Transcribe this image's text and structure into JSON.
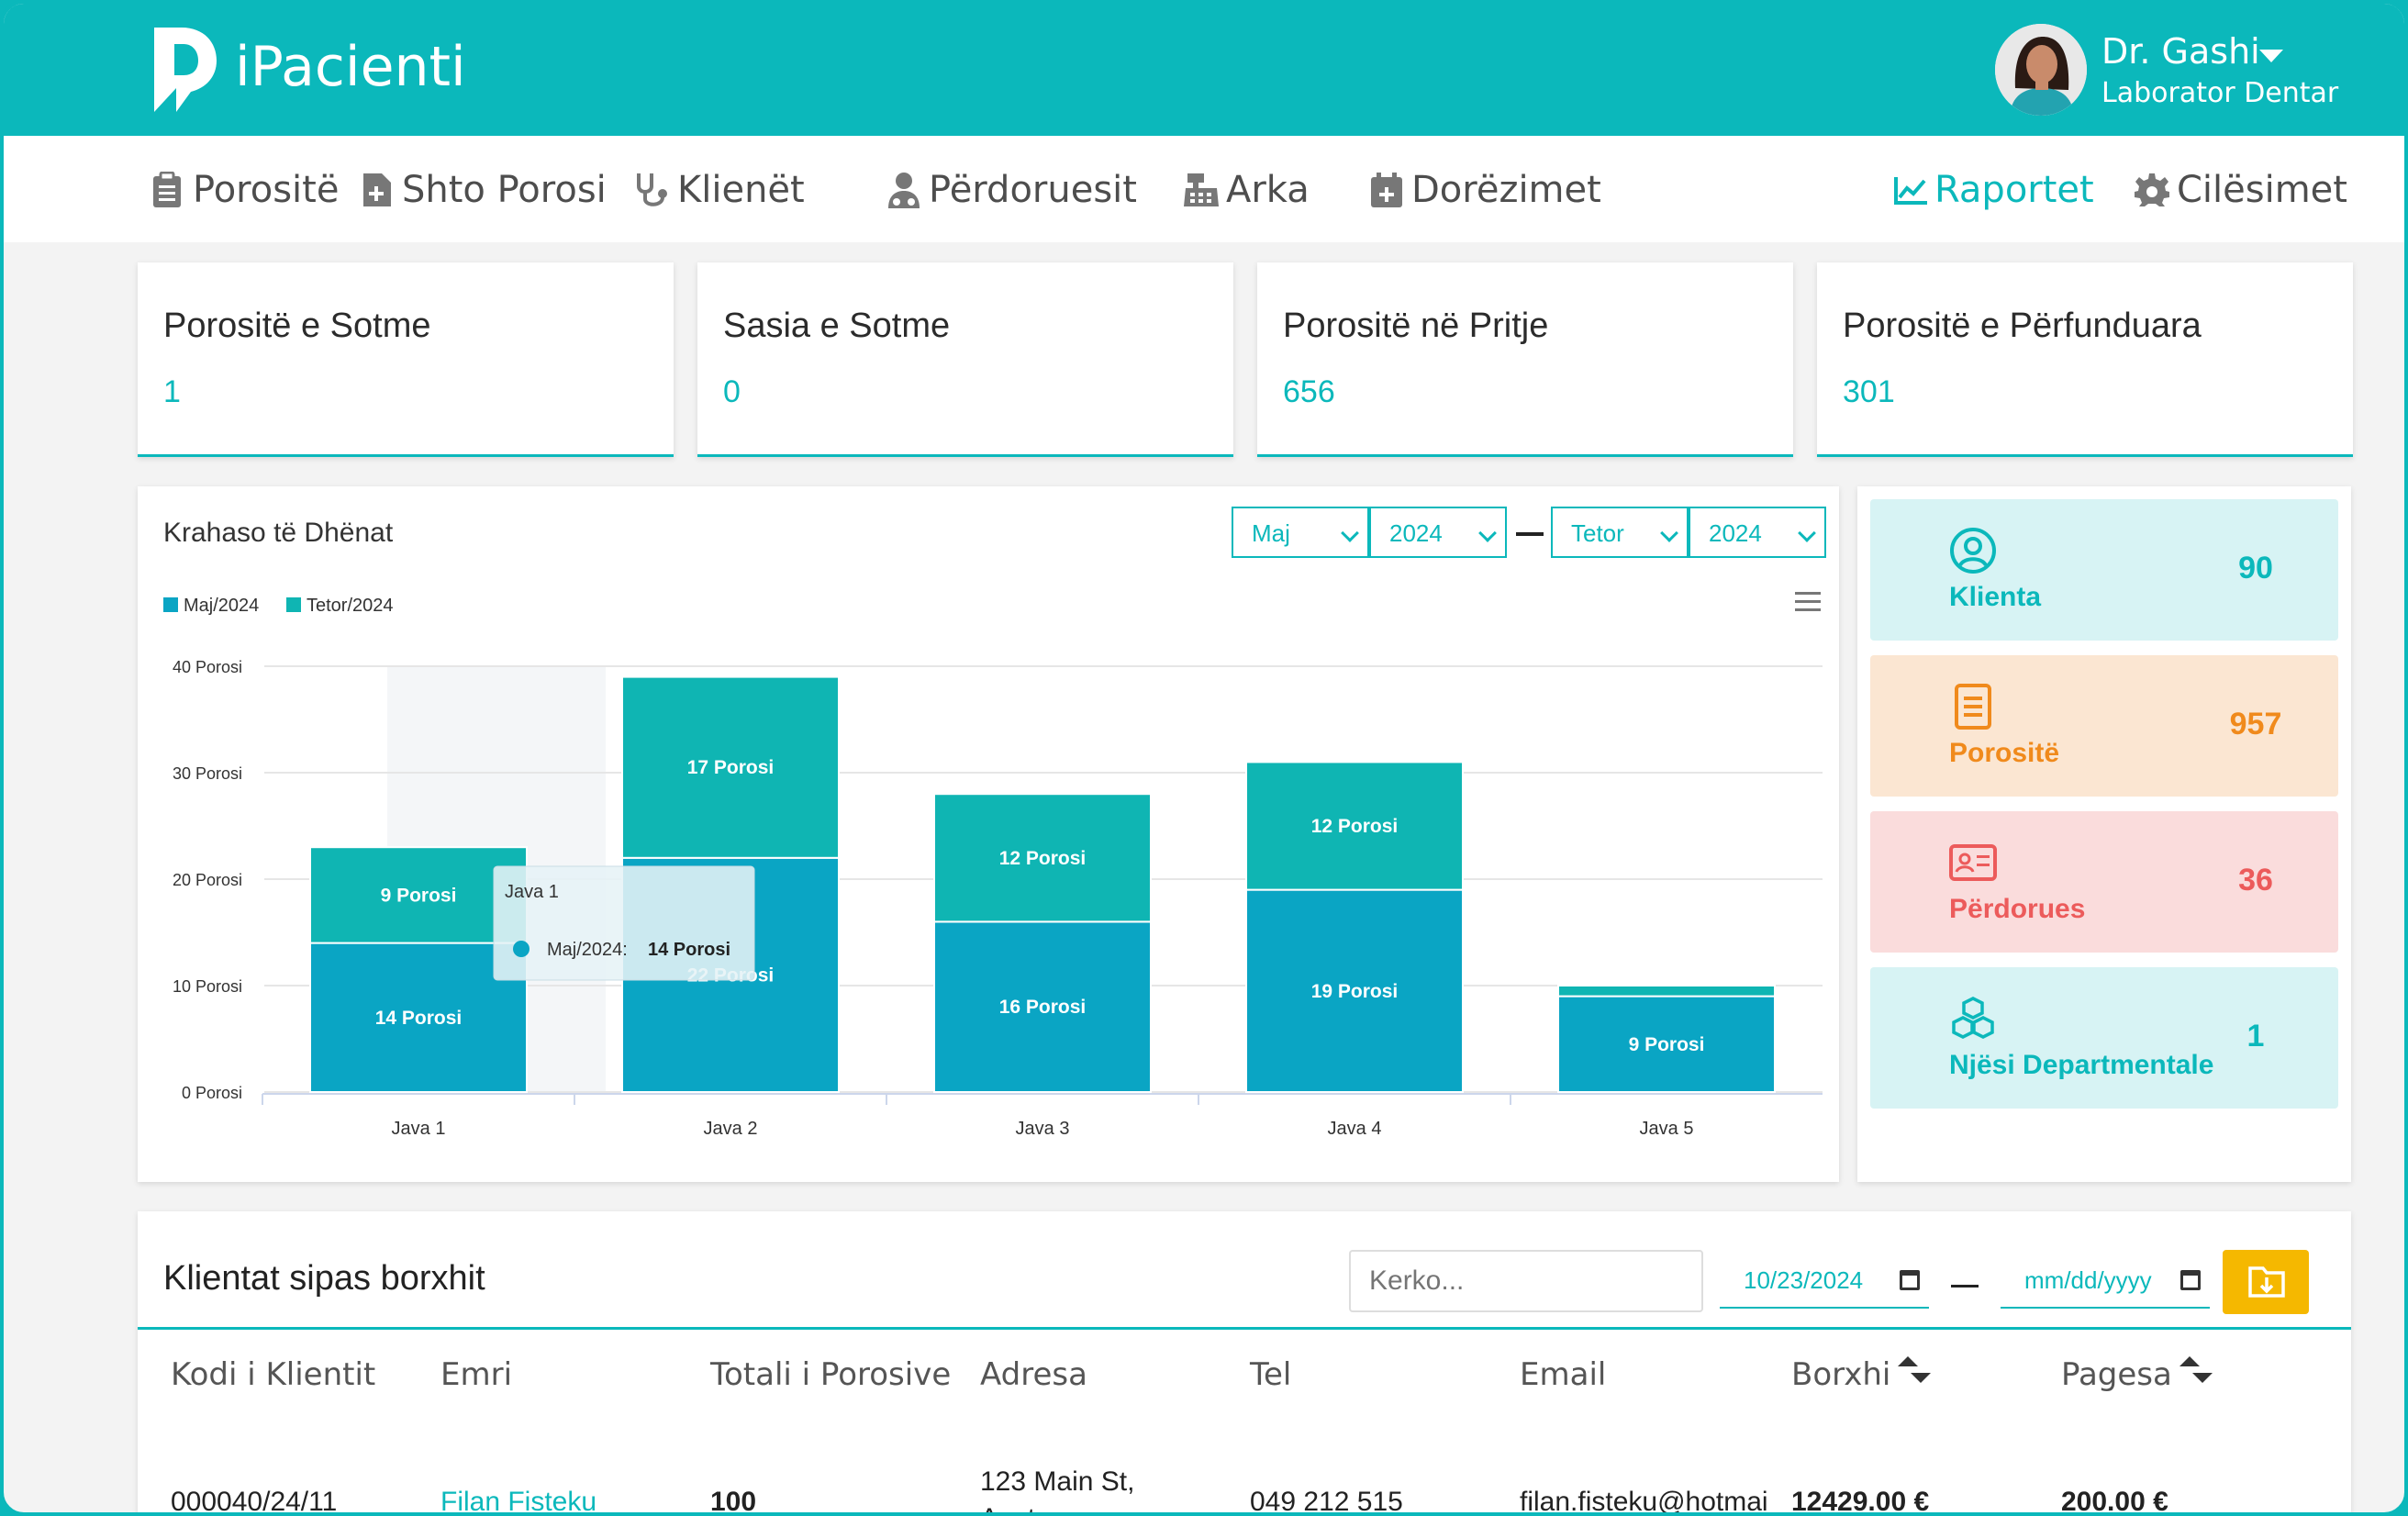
{
  "header": {
    "app_name": "iPacienti",
    "user_name": "Dr. Gashi",
    "user_role": "Laborator Dentar"
  },
  "nav": {
    "items": [
      {
        "label": "Porositë",
        "icon": "clipboard-icon"
      },
      {
        "label": "Shto Porosi",
        "icon": "file-plus-icon"
      },
      {
        "label": "Klienët",
        "icon": "stethoscope-icon"
      },
      {
        "label": "Përdoruesit",
        "icon": "users-icon"
      },
      {
        "label": "Arka",
        "icon": "cash-register-icon"
      },
      {
        "label": "Dorëzimet",
        "icon": "calendar-plus-icon"
      }
    ],
    "right": [
      {
        "label": "Raportet",
        "icon": "line-chart-icon",
        "active": true
      },
      {
        "label": "Cilësimet",
        "icon": "gear-icon"
      }
    ]
  },
  "stats": [
    {
      "title": "Porositë e Sotme",
      "value": "1"
    },
    {
      "title": "Sasia e Sotme",
      "value": "0"
    },
    {
      "title": "Porositë në Pritje",
      "value": "656"
    },
    {
      "title": "Porositë e Përfunduara",
      "value": "301"
    }
  ],
  "compare": {
    "title": "Krahaso të Dhënat",
    "from_month": "Maj",
    "from_year": "2024",
    "to_month": "Tetor",
    "to_year": "2024"
  },
  "chart_data": {
    "type": "bar",
    "stacked": true,
    "categories": [
      "Java 1",
      "Java 2",
      "Java 3",
      "Java 4",
      "Java 5"
    ],
    "series": [
      {
        "name": "Maj/2024",
        "values": [
          14,
          22,
          16,
          19,
          9
        ],
        "color": "#0aa5c4"
      },
      {
        "name": "Tetor/2024",
        "values": [
          9,
          17,
          12,
          12,
          1
        ],
        "color": "#0fb5b3"
      }
    ],
    "ylim": [
      0,
      40
    ],
    "yticks": [
      {
        "value": 0,
        "label": "0 Porosi"
      },
      {
        "value": 10,
        "label": "10 Porosi"
      },
      {
        "value": 20,
        "label": "20 Porosi"
      },
      {
        "value": 30,
        "label": "30 Porosi"
      },
      {
        "value": 40,
        "label": "40 Porosi"
      }
    ],
    "data_label_suffix": " Porosi",
    "legend_position": "top-left",
    "tooltip": {
      "title": "Java 1",
      "series": "Maj/2024:",
      "value": "14 Porosi"
    }
  },
  "side_cards": [
    {
      "label": "Klienta",
      "value": "90",
      "icon": "user-circle-icon",
      "color": "#0bb8bb",
      "bg": "#d7f3f4"
    },
    {
      "label": "Porositë",
      "value": "957",
      "icon": "document-icon",
      "color": "#f08a1c",
      "bg": "#fbe6d2"
    },
    {
      "label": "Përdorues",
      "value": "36",
      "icon": "id-card-icon",
      "color": "#ec5b5b",
      "bg": "#fadcdc"
    },
    {
      "label": "Njësi Departmentale",
      "value": "1",
      "icon": "cubes-icon",
      "color": "#0bb8bb",
      "bg": "#d7f3f4"
    }
  ],
  "debt_table": {
    "title": "Klientat sipas borxhit",
    "search_placeholder": "Kerko...",
    "date_from": "10/23/2024",
    "date_to": "mm/dd/yyyy",
    "columns": [
      "Kodi i Klientit",
      "Emri",
      "Totali i Porosive",
      "Adresa",
      "Tel",
      "Email",
      "Borxhi",
      "Pagesa"
    ],
    "rows": [
      {
        "code": "000040/24/11",
        "name": "Filan Fisteku",
        "total": "100",
        "address": "123 Main St,",
        "address2": "Anytown",
        "tel": "049 212 515",
        "email": "filan.fisteku@hotmai",
        "debt": "12429.00 €",
        "payment": "200.00 €"
      }
    ]
  }
}
